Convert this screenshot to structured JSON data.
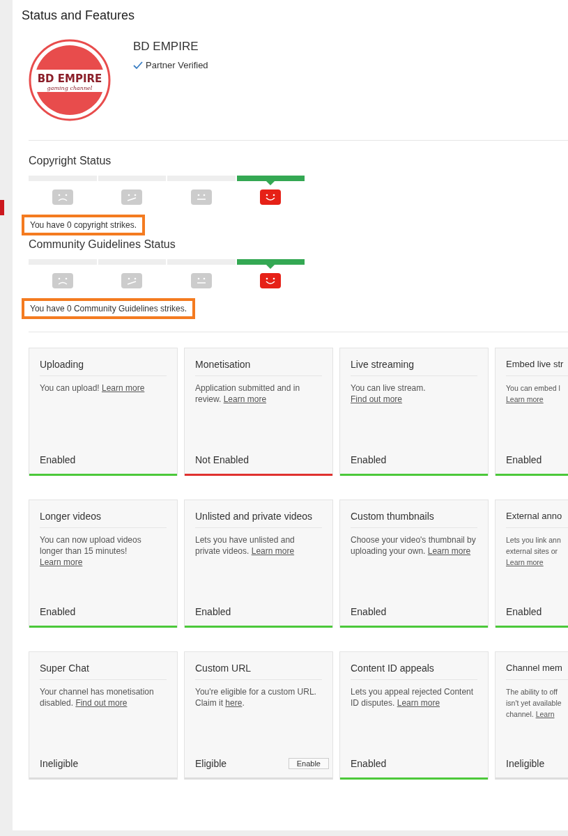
{
  "page_title": "Status and Features",
  "channel": {
    "logo": {
      "title": "BD EMPIRE",
      "subtitle": "gaming channel"
    },
    "name": "BD EMPIRE",
    "verified": true,
    "verified_label": "Partner Verified"
  },
  "statuses": [
    {
      "title": "Copyright Status",
      "segments": [
        {
          "kind": "sad",
          "selected": false
        },
        {
          "kind": "skeptical",
          "selected": false
        },
        {
          "kind": "neutral",
          "selected": false
        },
        {
          "kind": "happy",
          "selected": true
        }
      ],
      "message": "You have 0 copyright strikes.",
      "highlighted": true
    },
    {
      "title": "Community Guidelines Status",
      "segments": [
        {
          "kind": "sad",
          "selected": false
        },
        {
          "kind": "skeptical",
          "selected": false
        },
        {
          "kind": "neutral",
          "selected": false
        },
        {
          "kind": "happy",
          "selected": true
        }
      ],
      "message": "You have 0 Community Guidelines strikes.",
      "highlighted": true
    }
  ],
  "feature_rows": [
    [
      {
        "title": "Uploading",
        "description": [
          {
            "text": "You can upload! "
          },
          {
            "link": "Learn more"
          }
        ],
        "status": "Enabled",
        "kind": "enabled"
      },
      {
        "title": "Monetisation",
        "description": [
          {
            "text": "Application submitted and in review. "
          },
          {
            "link": "Learn more"
          }
        ],
        "status": "Not Enabled",
        "kind": "not_enabled"
      },
      {
        "title": "Live streaming",
        "description": [
          {
            "text": "You can live stream. "
          },
          {
            "link": "Find out more"
          }
        ],
        "status": "Enabled",
        "kind": "enabled"
      },
      {
        "title": "Embed live str",
        "description": [
          {
            "text": "You can embed l\n"
          },
          {
            "link": "Learn more"
          }
        ],
        "status": "Enabled",
        "kind": "enabled"
      }
    ],
    [
      {
        "title": "Longer videos",
        "description": [
          {
            "text": "You can now upload videos longer than 15 minutes! "
          },
          {
            "link": "Learn more"
          }
        ],
        "status": "Enabled",
        "kind": "enabled"
      },
      {
        "title": "Unlisted and private videos",
        "description": [
          {
            "text": "Lets you have unlisted and private videos. "
          },
          {
            "link": "Learn more"
          }
        ],
        "status": "Enabled",
        "kind": "enabled"
      },
      {
        "title": "Custom thumbnails",
        "description": [
          {
            "text": "Choose your video's thumbnail by uploading your own. "
          },
          {
            "link": "Learn more"
          }
        ],
        "status": "Enabled",
        "kind": "enabled"
      },
      {
        "title": "External anno",
        "description": [
          {
            "text": "Lets you link ann\nexternal sites or\n"
          },
          {
            "link": "Learn more"
          }
        ],
        "status": "Enabled",
        "kind": "enabled"
      }
    ],
    [
      {
        "title": "Super Chat",
        "description": [
          {
            "text": "Your channel has monetisation disabled. "
          },
          {
            "link": "Find out more"
          }
        ],
        "status": "Ineligible",
        "kind": "ineligible"
      },
      {
        "title": "Custom URL",
        "description": [
          {
            "text": "You're eligible for a custom URL. Claim it "
          },
          {
            "link": "here"
          },
          {
            "text": "."
          }
        ],
        "status": "Eligible",
        "kind": "eligible",
        "button": "Enable"
      },
      {
        "title": "Content ID appeals",
        "description": [
          {
            "text": "Lets you appeal rejected Content ID disputes. "
          },
          {
            "link": "Learn more"
          }
        ],
        "status": "Enabled",
        "kind": "enabled"
      },
      {
        "title": "Channel mem",
        "description": [
          {
            "text": "The ability to off\nisn't yet available\nchannel. "
          },
          {
            "link": "Learn"
          }
        ],
        "status": "Ineligible",
        "kind": "ineligible"
      }
    ]
  ]
}
